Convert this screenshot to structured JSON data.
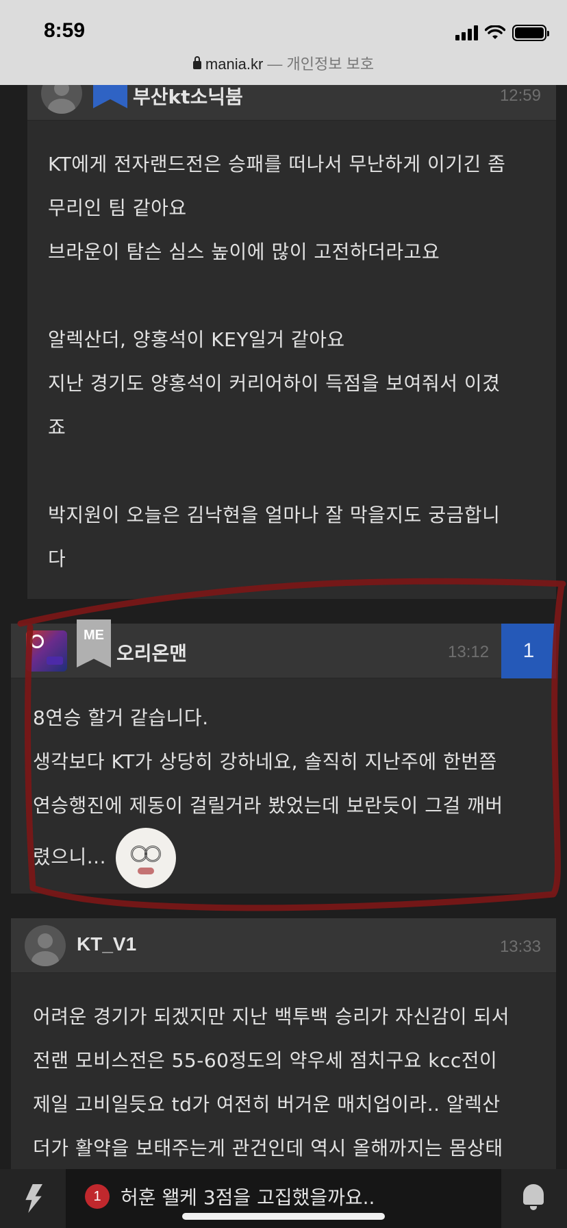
{
  "status_bar": {
    "time": "8:59",
    "url": "mania.kr",
    "privacy": "— 개인정보 보호"
  },
  "comments": [
    {
      "nickname": "부산kt소닉붐",
      "time": "12:59",
      "lines": [
        "KT에게 전자랜드전은 승패를 떠나서 무난하게 이기긴 좀",
        "무리인 팀 같아요",
        "브라운이 탐슨 심스 높이에 많이 고전하더라고요",
        "",
        "알렉산더, 양홍석이 KEY일거 같아요",
        "지난 경기도 양홍석이 커리어하이 득점을 보여줘서 이겼",
        "죠",
        "",
        "박지원이 오늘은 김낙현을 얼마나 잘 막을지도 궁금합니",
        "다"
      ]
    },
    {
      "badge": "ME",
      "nickname": "오리온맨",
      "time": "13:12",
      "reply_count": "1",
      "lines": [
        "8연승 할거 같습니다.",
        "생각보다 KT가 상당히 강하네요, 솔직히 지난주에 한번쯤",
        "연승행진에 제동이 걸릴거라 봤었는데 보란듯이 그걸 깨버",
        "렸으니..."
      ]
    },
    {
      "nickname": "KT_V1",
      "time": "13:33",
      "lines": [
        "어려운 경기가 되겠지만 지난 백투백 승리가 자신감이 되서",
        "전랜 모비스전은 55-60정도의 약우세 점치구요 kcc전이",
        "제일 고비일듯요 td가 여전히 버거운 매치업이라.. 알렉산",
        "더가 활약을 보태주는게 관건인데 역시 올해까지는 몸상태"
      ]
    }
  ],
  "bottom_bar": {
    "ticker_number": "1",
    "ticker_text": "허훈 왤케 3점을 고집했을까요.."
  },
  "colors": {
    "background": "#1e1e1e",
    "card": "#2c2c2c",
    "accent_blue": "#2559b8",
    "marker_red": "#8a1a1a"
  }
}
